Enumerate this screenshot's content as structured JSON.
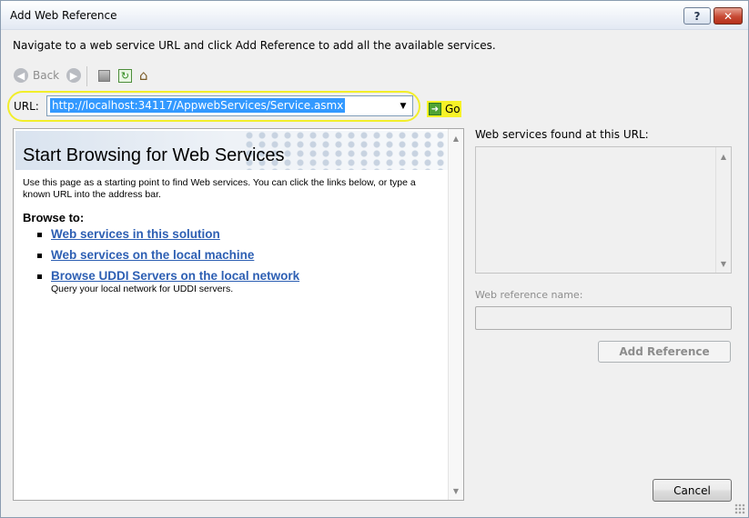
{
  "window": {
    "title": "Add Web Reference",
    "help_label": "?",
    "close_label": "✕"
  },
  "instruction": "Navigate to a web service URL and click Add Reference to add all the available services.",
  "toolbar": {
    "back_label": "Back",
    "icons": [
      "back-icon",
      "forward-icon",
      "stop-icon",
      "refresh-icon",
      "home-icon"
    ]
  },
  "url": {
    "label": "URL:",
    "value": "http://localhost:34117/AppwebServices/Service.asmx",
    "go_label": "Go"
  },
  "browser": {
    "title": "Start Browsing for Web Services",
    "intro": "Use this page as a starting point to find Web services. You can click the links below, or type a known URL into the address bar.",
    "browse_to": "Browse to:",
    "links": [
      {
        "label": "Web services in this solution",
        "description": ""
      },
      {
        "label": "Web services on the local machine",
        "description": ""
      },
      {
        "label": "Browse UDDI Servers on the local network",
        "description": "Query your local network for UDDI servers."
      }
    ]
  },
  "right_panel": {
    "found_label": "Web services found at this URL:",
    "ref_name_label": "Web reference name:",
    "ref_name_value": "",
    "add_reference_label": "Add Reference"
  },
  "footer": {
    "cancel_label": "Cancel"
  },
  "colors": {
    "accent_link": "#2d5fb3",
    "highlight_yellow": "#f2ee2a",
    "selection_blue": "#3399ff"
  }
}
